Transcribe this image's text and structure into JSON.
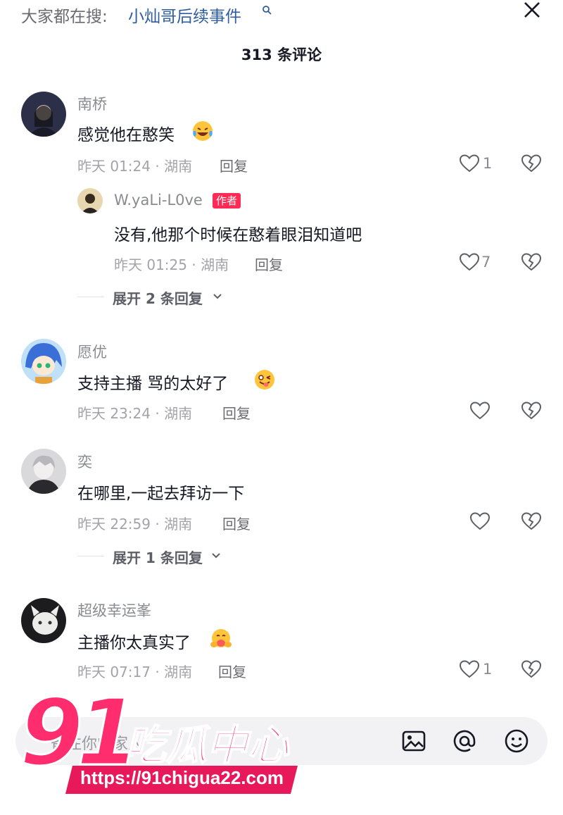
{
  "top": {
    "search_label": "大家都在搜:",
    "search_query": "小灿哥后续事件",
    "comment_count_title": "313 条评论"
  },
  "comments": [
    {
      "username": "南桥",
      "text": "感觉他在憨笑",
      "emoji": "laugh-cry-emoji",
      "time_location": "昨天 01:24 · 湖南",
      "reply_label": "回复",
      "likes": "1",
      "reply": {
        "username": "W.yaLi-L0ve",
        "author_tag": "作者",
        "text": "没有,他那个时候在憨着眼泪知道吧",
        "time_location": "昨天 01:25 · 湖南",
        "reply_label": "回复",
        "likes": "7"
      },
      "expand_label": "展开 2 条回复"
    },
    {
      "username": "愿优",
      "text": "支持主播 骂的太好了",
      "emoji": "wink-tongue-emoji",
      "time_location": "昨天 23:24 · 湖南",
      "reply_label": "回复",
      "likes": ""
    },
    {
      "username": "奕",
      "text": "在哪里,一起去拜访一下",
      "time_location": "昨天 22:59 · 湖南",
      "reply_label": "回复",
      "likes": "",
      "expand_label": "展开 1 条回复"
    },
    {
      "username": "超级幸运峯",
      "text": "主播你太真实了",
      "emoji": "hug-emoji",
      "time_location": "昨天 07:17 · 湖南",
      "reply_label": "回复",
      "likes": "1"
    }
  ],
  "input": {
    "placeholder": "备注你的家人"
  },
  "watermark": {
    "big": "91",
    "cn": "吃瓜中心",
    "url": "https://91chigua22.com"
  },
  "colors": {
    "link": "#2f5d9e",
    "author_tag": "#fe2c55",
    "watermark": "#ff2d6e"
  }
}
